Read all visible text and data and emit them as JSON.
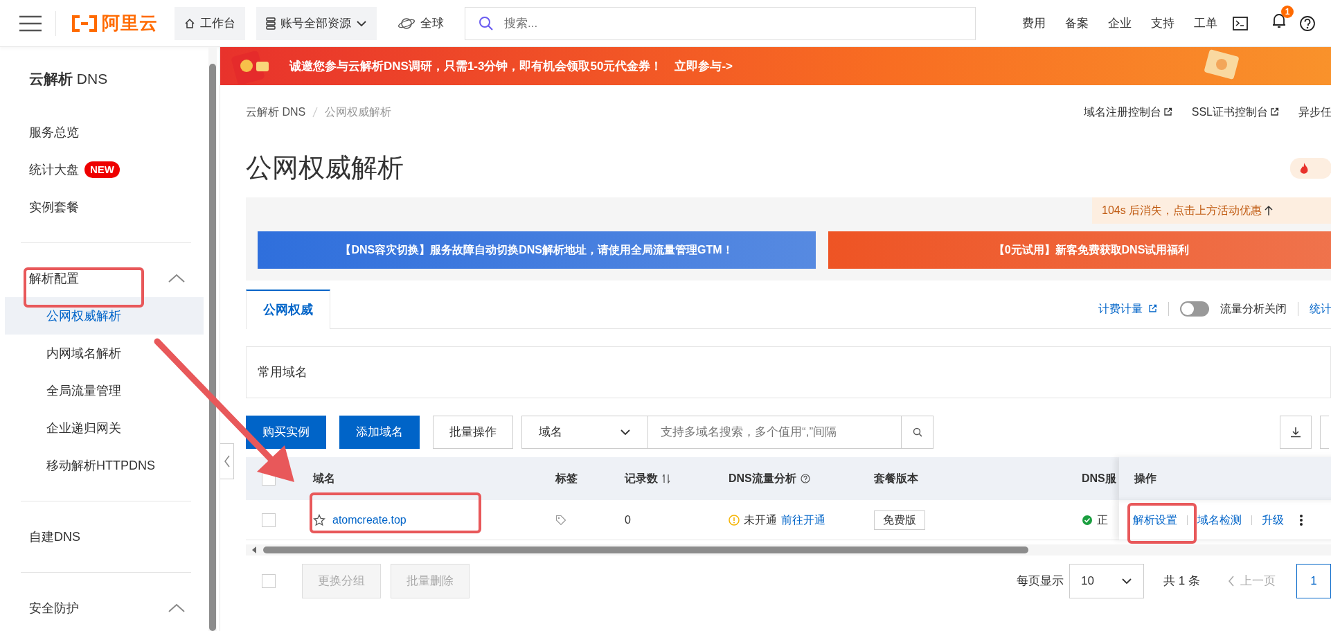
{
  "topbar": {
    "logo": "阿里云",
    "nav": [
      {
        "label": "工作台",
        "kind": "button",
        "dropdown": false
      },
      {
        "label": "账号全部资源",
        "kind": "button",
        "dropdown": true
      },
      {
        "label": "全球",
        "kind": "plain",
        "dropdown": false
      }
    ],
    "search": {
      "placeholder": "搜索..."
    },
    "links": [
      "费用",
      "备案",
      "企业",
      "支持",
      "工单"
    ],
    "notifications": {
      "count": "1"
    }
  },
  "sidebar": {
    "title": "**云解析** DNS",
    "groups": [
      {
        "kind": "section",
        "items": [
          {
            "label": "服务总览"
          },
          {
            "label": "统计大盘",
            "badge": "NEW"
          },
          {
            "label": "实例套餐"
          }
        ]
      },
      {
        "kind": "group",
        "label": "解析配置",
        "expanded": true,
        "children": [
          {
            "label": "公网权威解析",
            "selected": true
          },
          {
            "label": "内网域名解析",
            "selected": false
          },
          {
            "label": "全局流量管理",
            "selected": false
          },
          {
            "label": "企业递归网关",
            "selected": false
          },
          {
            "label": "移动解析HTTPDNS",
            "selected": false
          }
        ]
      },
      {
        "kind": "section",
        "items": [
          {
            "label": "自建DNS"
          }
        ]
      },
      {
        "kind": "group",
        "label": "安全防护",
        "expanded": true
      }
    ]
  },
  "promo_banner": {
    "text": "诚邀您参与云解析DNS调研，只需1-3分钟，即有机会领取50元代金券！",
    "link": "立即参与->"
  },
  "breadcrumb": [
    "云解析 DNS",
    "公网权威解析"
  ],
  "header_links": [
    {
      "label": "域名注册控制台",
      "external": true
    },
    {
      "label": "SSL证书控制台",
      "external": true
    },
    {
      "label": "异步任",
      "external": false
    }
  ],
  "page_title": "公网权威解析",
  "notice": {
    "timer": "104s 后消失，点击上方活动优惠"
  },
  "ads": [
    {
      "text": "【DNS容灾切换】服务故障自动切换DNS解析地址，请使用全局流量管理GTM！",
      "color": "#2f6fdc"
    },
    {
      "text": "【0元试用】新客免费获取DNS试用福利",
      "color": "#ee5424"
    }
  ],
  "tabs": [
    {
      "label": "公网权威",
      "selected": true
    }
  ],
  "tab_actions": {
    "billing": "计费计量",
    "toggle": {
      "label": "流量分析关闭",
      "on": false
    },
    "stats": "统计"
  },
  "group_filter": {
    "label": "常用域名"
  },
  "toolbar": {
    "buttons": [
      {
        "label": "购买实例",
        "kind": "primary"
      },
      {
        "label": "添加域名",
        "kind": "primary"
      },
      {
        "label": "批量操作",
        "kind": "secondary"
      }
    ],
    "search_type": "域名",
    "search_placeholder": "支持多域名搜索，多个值用“,”间隔"
  },
  "table": {
    "header_checked": false,
    "columns": [
      {
        "label": "域名"
      },
      {
        "label": "标签"
      },
      {
        "label": "记录数",
        "sortable": true
      },
      {
        "label": "DNS流量分析",
        "help": true
      },
      {
        "label": "套餐版本"
      },
      {
        "label": "DNS服"
      },
      {
        "label": "操作"
      }
    ],
    "rows": [
      {
        "checked": false,
        "starred": false,
        "domain": "atomcreate.top",
        "record_count": "0",
        "traffic": {
          "status": "未开通",
          "link": "前往开通"
        },
        "plan": "免费版",
        "dns_status": "正",
        "actions": [
          "解析设置",
          "域名检测",
          "升级"
        ]
      }
    ]
  },
  "footer": {
    "checked": false,
    "buttons": [
      {
        "label": "更换分组",
        "disabled": true
      },
      {
        "label": "批量删除",
        "disabled": true
      }
    ],
    "page_size_label": "每页显示",
    "page_size": "10",
    "total": "共 1 条",
    "prev": "上一页",
    "pages": [
      {
        "label": "1",
        "selected": true
      }
    ]
  }
}
